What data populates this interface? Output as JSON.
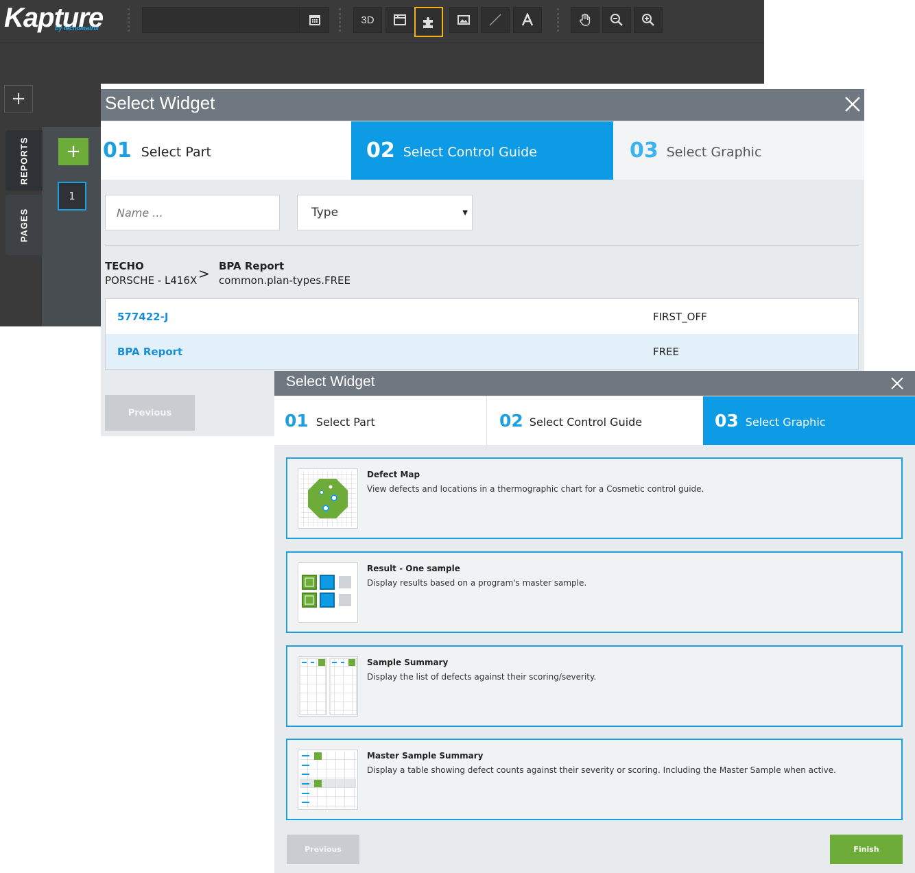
{
  "app": {
    "logo": "Kapture",
    "logo_sub": "by tecnomatrix",
    "toolbar": {
      "date_input_value": "",
      "btn_3d": "3D",
      "add_button": "+",
      "tabs": {
        "reports": "REPORTS",
        "pages": "PAGES"
      },
      "green_add": "+",
      "page_number": "1"
    }
  },
  "dialog1": {
    "title": "Select Widget",
    "steps": [
      {
        "num": "01",
        "label": "Select Part"
      },
      {
        "num": "02",
        "label": "Select Control Guide"
      },
      {
        "num": "03",
        "label": "Select Graphic"
      }
    ],
    "name_placeholder": "Name ...",
    "type_select": "Type",
    "breadcrumb": {
      "part_title": "TECHO",
      "part_sub": "PORSCHE - L416X",
      "separator": ">",
      "guide_title": "BPA Report",
      "guide_sub": "common.plan-types.FREE"
    },
    "rows": [
      {
        "name": "577422-J",
        "type": "FIRST_OFF"
      },
      {
        "name": "BPA Report",
        "type": "FREE"
      }
    ],
    "previous": "Previous"
  },
  "dialog2": {
    "title": "Select Widget",
    "steps": [
      {
        "num": "01",
        "label": "Select Part"
      },
      {
        "num": "02",
        "label": "Select Control Guide"
      },
      {
        "num": "03",
        "label": "Select Graphic"
      }
    ],
    "cards": [
      {
        "title": "Defect Map",
        "desc": "View defects and locations in a thermographic chart for a Cosmetic control guide."
      },
      {
        "title": "Result - One sample",
        "desc": "Display results based on a program's master sample."
      },
      {
        "title": "Sample Summary",
        "desc": "Display the list of defects against their scoring/severity."
      },
      {
        "title": "Master Sample Summary",
        "desc": "Display a table showing defect counts against their severity or scoring. Including the Master Sample when active."
      }
    ],
    "previous": "Previous",
    "finish": "Finish"
  },
  "colors": {
    "accent": "#0d9be5",
    "highlight": "#f2b21b",
    "green": "#6eac3a",
    "toolbar_bg": "#3a3a3a"
  }
}
